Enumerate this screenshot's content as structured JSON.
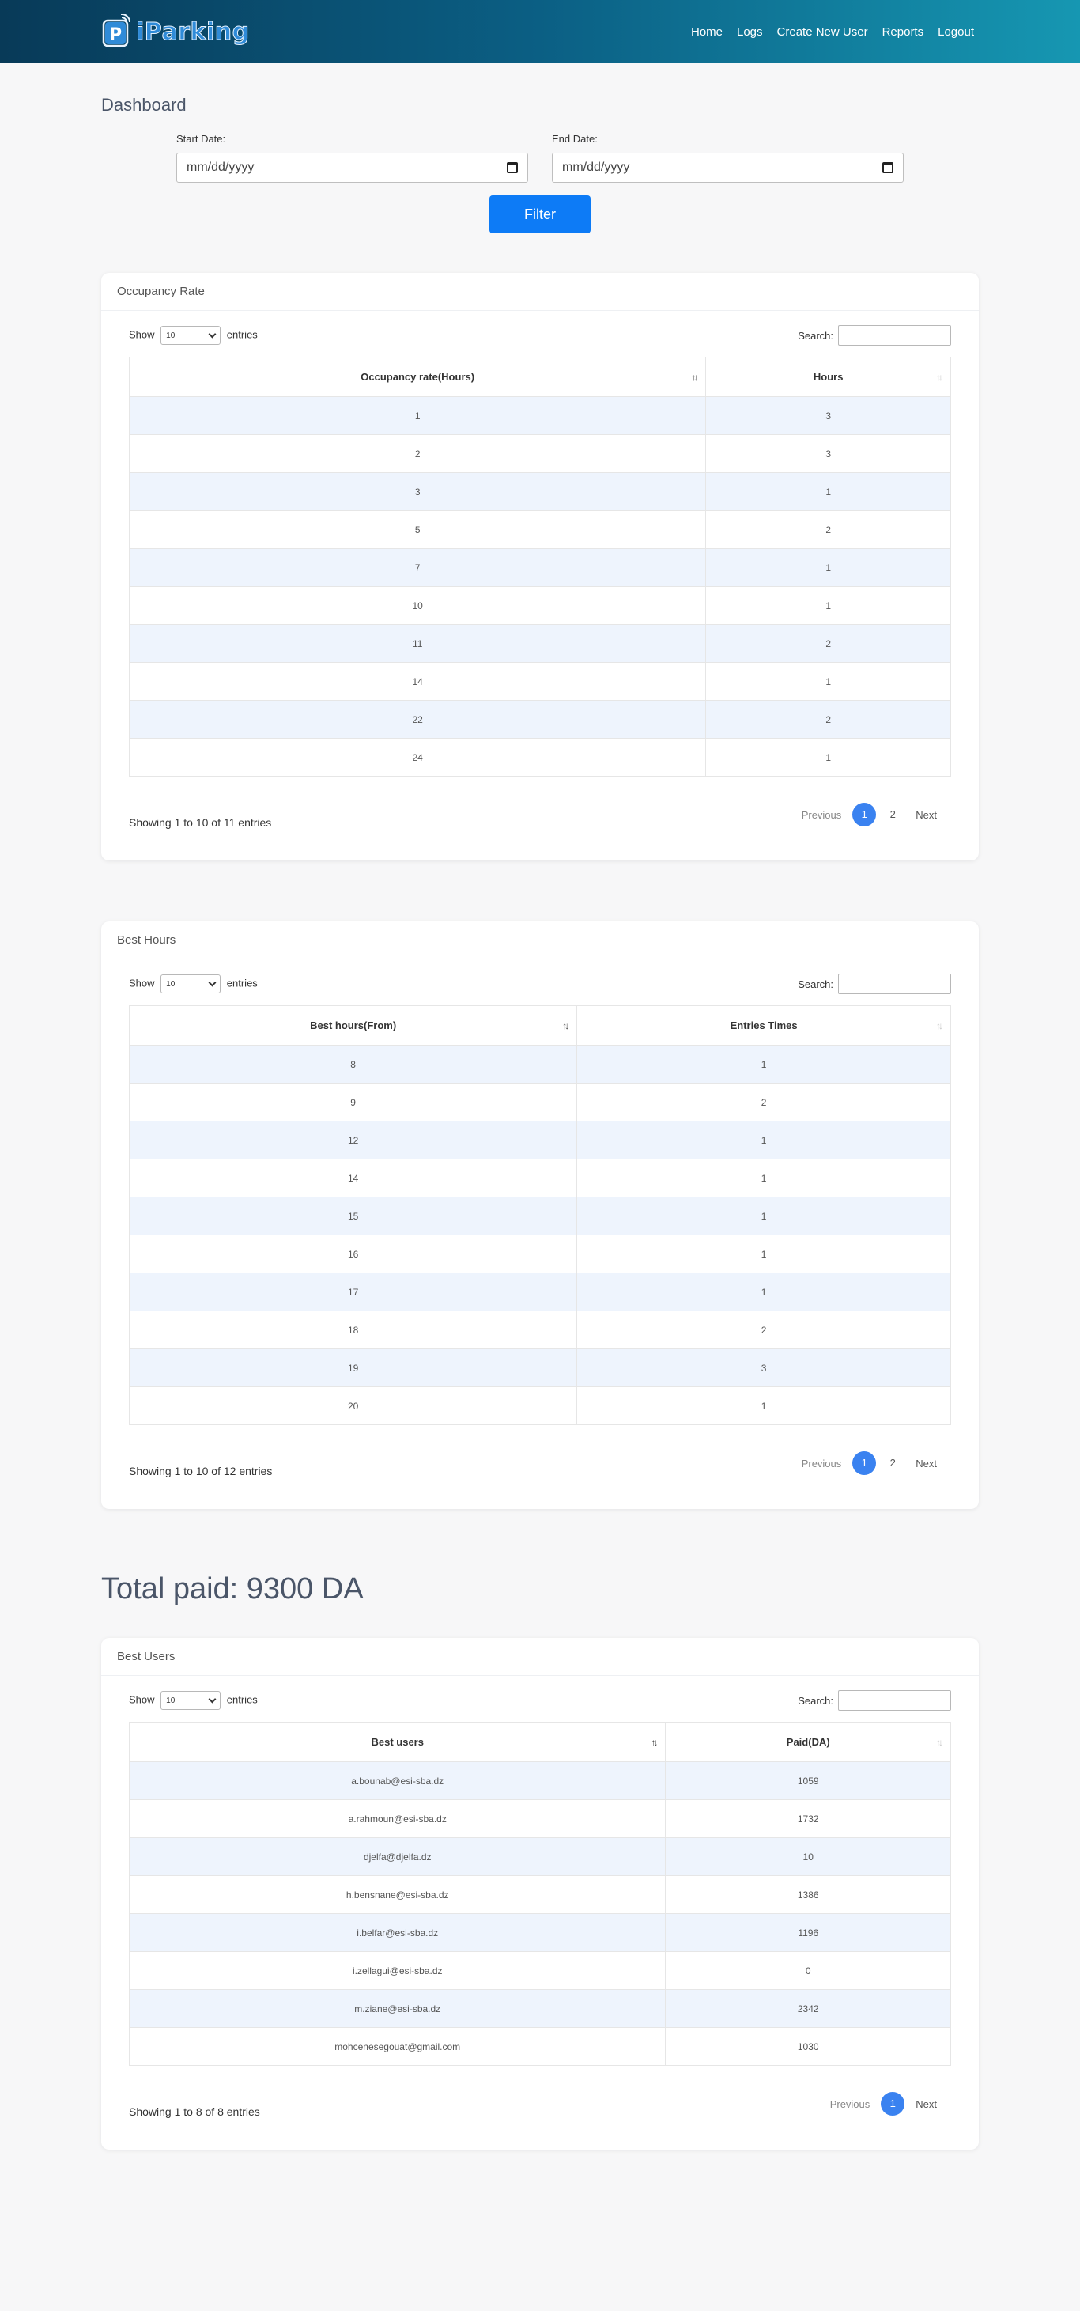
{
  "brand": {
    "name": "iParking"
  },
  "nav": [
    "Home",
    "Logs",
    "Create New User",
    "Reports",
    "Logout"
  ],
  "page_title": "Dashboard",
  "filter": {
    "start_label": "Start Date:",
    "end_label": "End Date:",
    "start_value": "mm/dd/yyyy",
    "end_value": "mm/dd/yyyy",
    "button": "Filter"
  },
  "table_controls": {
    "show": "Show",
    "entries": "entries",
    "search": "Search:",
    "length": "10",
    "previous": "Previous",
    "next": "Next"
  },
  "occupancy": {
    "title": "Occupancy Rate",
    "col1": "Occupancy rate(Hours)",
    "col2": "Hours",
    "rows": [
      [
        "1",
        "3"
      ],
      [
        "2",
        "3"
      ],
      [
        "3",
        "1"
      ],
      [
        "5",
        "2"
      ],
      [
        "7",
        "1"
      ],
      [
        "10",
        "1"
      ],
      [
        "11",
        "2"
      ],
      [
        "14",
        "1"
      ],
      [
        "22",
        "2"
      ],
      [
        "24",
        "1"
      ]
    ],
    "info": "Showing 1 to 10 of 11 entries",
    "pages": [
      "1",
      "2"
    ]
  },
  "best_hours": {
    "title": "Best Hours",
    "col1": "Best hours(From)",
    "col2": "Entries Times",
    "rows": [
      [
        "8",
        "1"
      ],
      [
        "9",
        "2"
      ],
      [
        "12",
        "1"
      ],
      [
        "14",
        "1"
      ],
      [
        "15",
        "1"
      ],
      [
        "16",
        "1"
      ],
      [
        "17",
        "1"
      ],
      [
        "18",
        "2"
      ],
      [
        "19",
        "3"
      ],
      [
        "20",
        "1"
      ]
    ],
    "info": "Showing 1 to 10 of 12 entries",
    "pages": [
      "1",
      "2"
    ]
  },
  "total_paid": "Total paid: 9300 DA",
  "best_users": {
    "title": "Best Users",
    "col1": "Best users",
    "col2": "Paid(DA)",
    "rows": [
      [
        "a.bounab@esi-sba.dz",
        "1059"
      ],
      [
        "a.rahmoun@esi-sba.dz",
        "1732"
      ],
      [
        "djelfa@djelfa.dz",
        "10"
      ],
      [
        "h.bensnane@esi-sba.dz",
        "1386"
      ],
      [
        "i.belfar@esi-sba.dz",
        "1196"
      ],
      [
        "i.zellagui@esi-sba.dz",
        "0"
      ],
      [
        "m.ziane@esi-sba.dz",
        "2342"
      ],
      [
        "mohcenesegouat@gmail.com",
        "1030"
      ]
    ],
    "info": "Showing 1 to 8 of 8 entries",
    "pages": [
      "1"
    ]
  }
}
